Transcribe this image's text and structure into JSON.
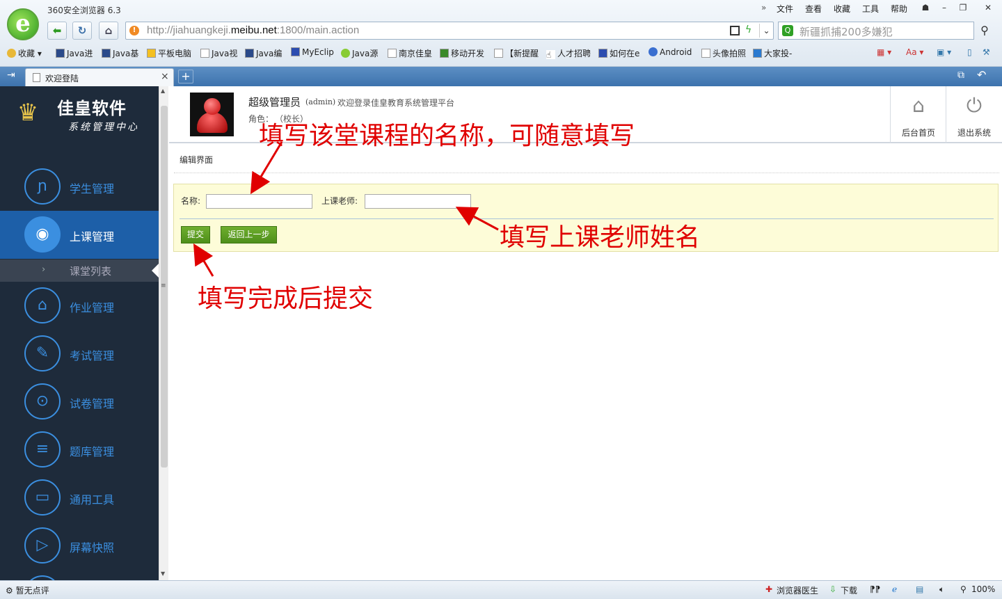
{
  "browser": {
    "app_title": "360安全浏览器 6.3",
    "menu": [
      "文件",
      "查看",
      "收藏",
      "工具",
      "帮助"
    ],
    "url_prefix": "http://jiahuangkeji.",
    "url_domain": "meibu.net",
    "url_suffix": ":1800/main.action",
    "search_text": "新疆抓捕200多嫌犯",
    "bookmarks": [
      "收藏",
      "Java进",
      "Java基",
      "平板电脑",
      "Java视",
      "Java编",
      "MyEclip",
      "Java源",
      "南京佳皇",
      "移动开发",
      "【新提醒",
      "人才招聘",
      "如何在e",
      "Android",
      "头像拍照",
      "大家投-"
    ],
    "tab_title": "欢迎登陆"
  },
  "sidebar": {
    "brand_name": "佳皇软件",
    "brand_sub": "系统管理中心",
    "items": [
      {
        "label": "学生管理",
        "icon": "student-icon"
      },
      {
        "label": "上课管理",
        "icon": "eye-icon"
      },
      {
        "label": "作业管理",
        "icon": "home-icon"
      },
      {
        "label": "考试管理",
        "icon": "edit-icon"
      },
      {
        "label": "试卷管理",
        "icon": "location-icon"
      },
      {
        "label": "题库管理",
        "icon": "list-icon"
      },
      {
        "label": "通用工具",
        "icon": "toolbox-icon"
      },
      {
        "label": "屏幕快照",
        "icon": "video-icon"
      }
    ],
    "subitem": "课堂列表"
  },
  "header": {
    "user_name": "超级管理员",
    "user_id": "(admin)",
    "welcome": "欢迎登录佳皇教育系统管理平台",
    "role_label": "角色：",
    "role_value": "（校长）",
    "home_label": "后台首页",
    "logout_label": "退出系统"
  },
  "content": {
    "crumb": "编辑界面",
    "name_label": "名称:",
    "name_value": "",
    "teacher_label": "上课老师:",
    "teacher_value": "",
    "submit_label": "提交",
    "back_label": "返回上一步"
  },
  "annotations": {
    "a1": "填写该堂课程的名称，可随意填写",
    "a2": "填写上课老师姓名",
    "a3": "填写完成后提交"
  },
  "status": {
    "left": "暂无点评",
    "doctor": "浏览器医生",
    "download": "下载",
    "zoom": "100%"
  },
  "colors": {
    "sidebar_bg": "#1e2b3b",
    "accent": "#3b8fe0",
    "active_bg": "#1d5fa8",
    "panel_bg": "#fdfcd8",
    "button_green": "#5a9e22",
    "annotation_red": "#e00000"
  }
}
